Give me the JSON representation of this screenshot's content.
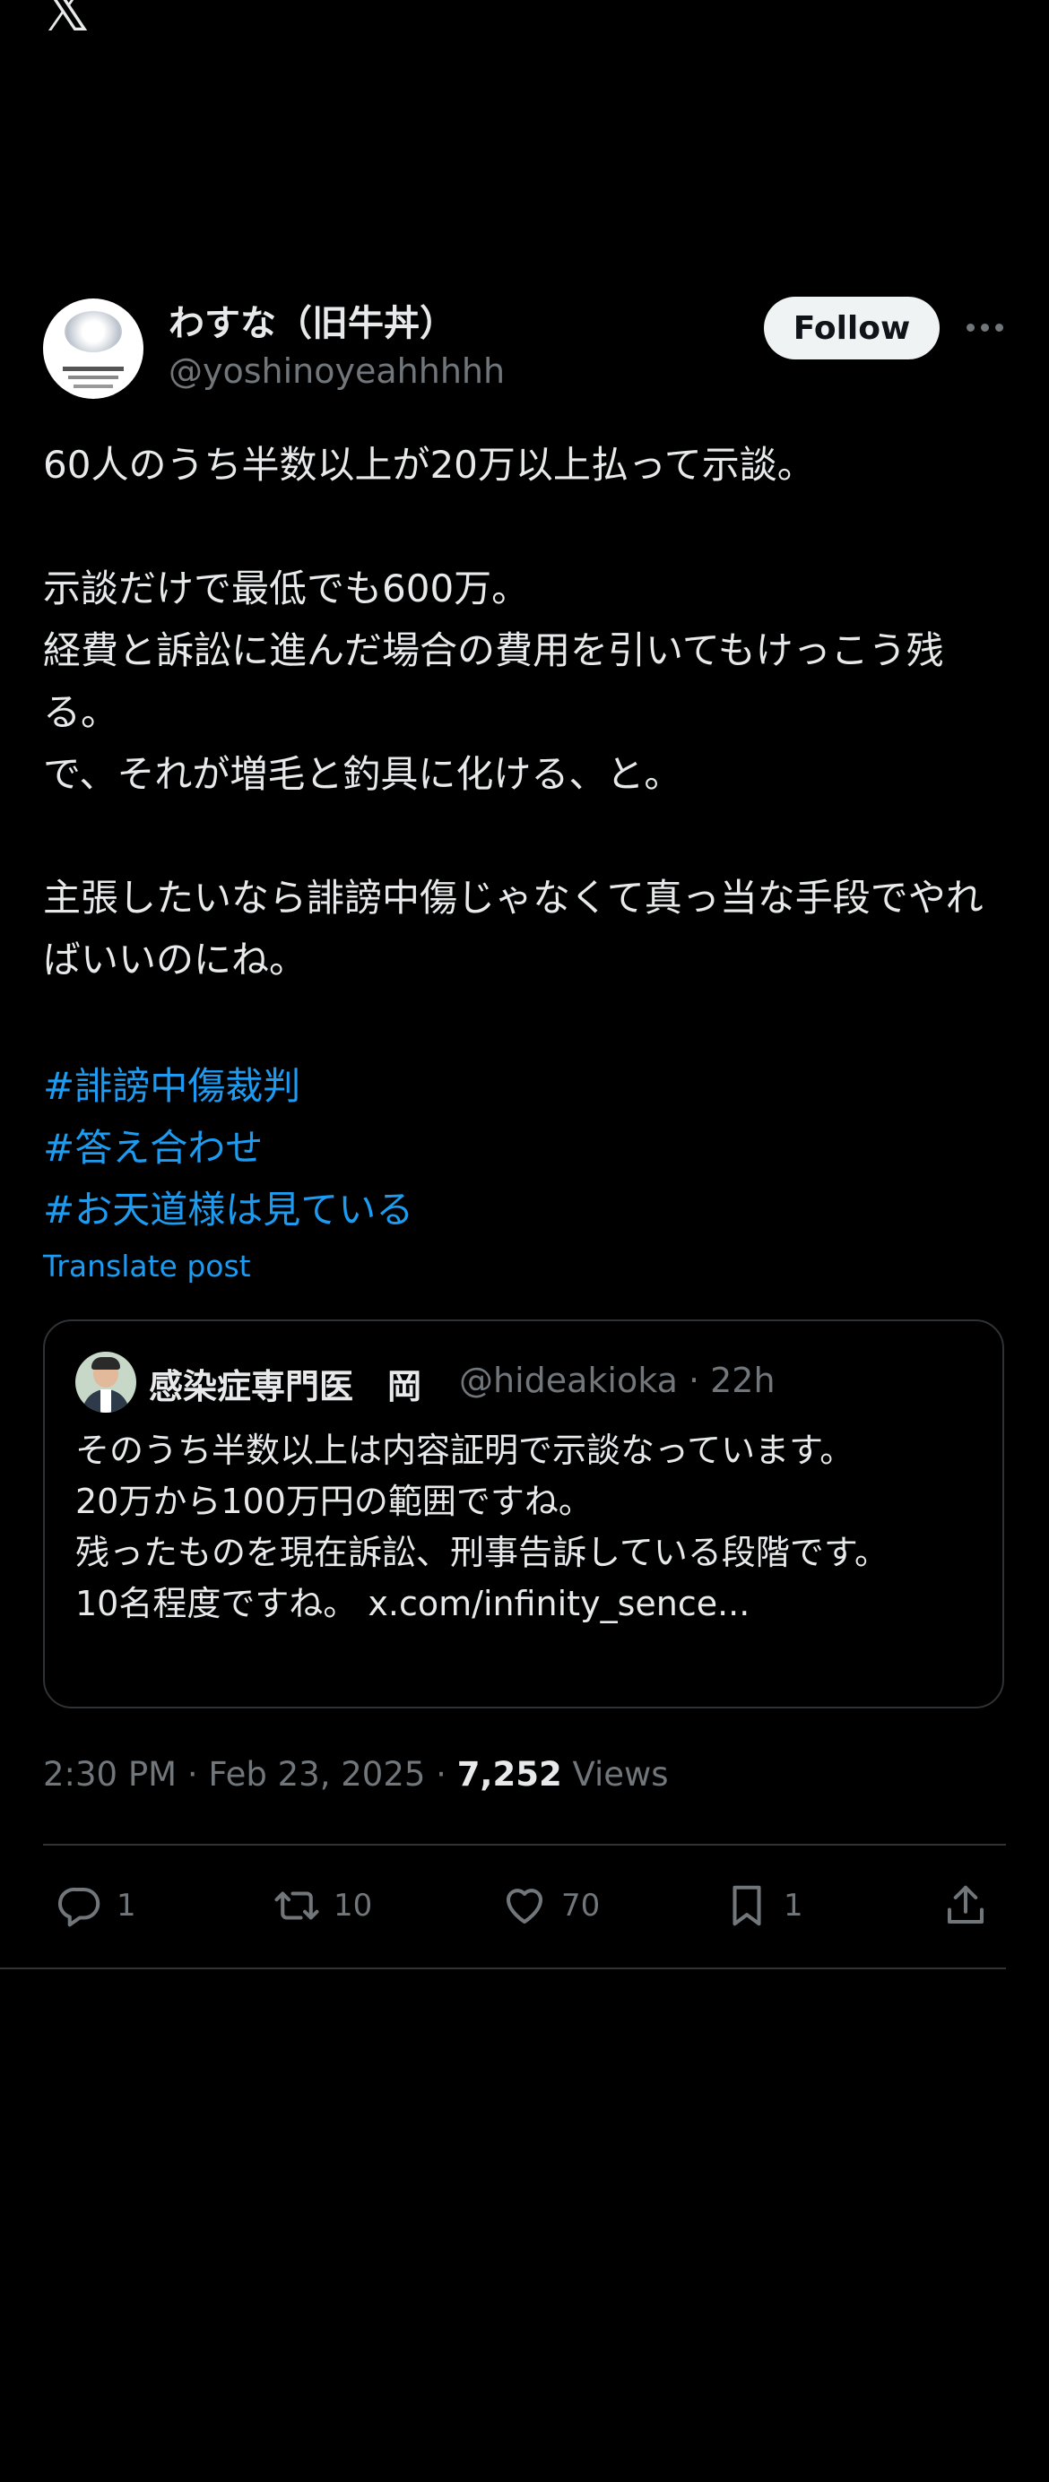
{
  "nav": {
    "close_glyph": "𝕏"
  },
  "author": {
    "display_name": "わすな（旧牛丼）",
    "handle": "@yoshinoyeahhhhh",
    "follow_label": "Follow"
  },
  "post": {
    "text": "60人のうち半数以上が20万以上払って示談。\n\n示談だけで最低でも600万。\n経費と訴訟に進んだ場合の費用を引いてもけっこう残る。\nで、それが増毛と釣具に化ける、と。\n\n主張したいなら誹謗中傷じゃなくて真っ当な手段でやればいいのにね。",
    "hashtags": [
      "#誹謗中傷裁判",
      "#答え合わせ",
      "#お天道様は見ている"
    ],
    "translate_label": "Translate post"
  },
  "quoted": {
    "name": "感染症専門医　岡",
    "handle_time": "@hideakioka · 22h",
    "text": "そのうち半数以上は内容証明で示談なっています。\n20万から100万円の範囲ですね。\n残ったものを現在訴訟、刑事告訴している段階です。\n10名程度ですね。 x.com/infinity_sence..."
  },
  "meta": {
    "time_date": "2:30 PM · Feb 23, 2025 · ",
    "views_count": "7,252",
    "views_label": " Views"
  },
  "actions": {
    "reply": {
      "icon": "reply-icon",
      "count": "1"
    },
    "repost": {
      "icon": "repost-icon",
      "count": "10"
    },
    "like": {
      "icon": "heart-icon",
      "count": "70"
    },
    "bookmark": {
      "icon": "bookmark-icon",
      "count": "1"
    },
    "share": {
      "icon": "share-icon"
    }
  },
  "colors": {
    "background": "#000000",
    "text": "#e7e9ea",
    "secondary": "#71767b",
    "link": "#1d9bf0",
    "border": "#2f3336"
  }
}
